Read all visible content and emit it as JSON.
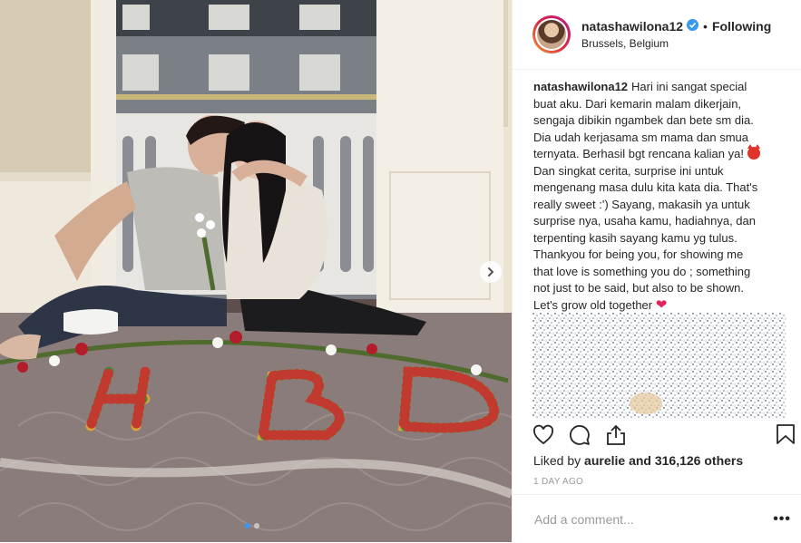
{
  "post": {
    "username": "natashawilona12",
    "follow_status": "Following",
    "separator": "•",
    "location": "Brussels, Belgium",
    "caption_lines": [
      "Hari ini sangat special",
      "buat aku. Dari kemarin malam dikerjain,",
      "sengaja dibikin ngambek dan bete sm dia.",
      "Dia udah kerjasama sm mama dan smua",
      "ternyata. Berhasil bgt rencana kalian ya!",
      "Dan singkat cerita, surprise ini untuk",
      "mengenang masa dulu kita kata dia. That's",
      "really sweet :') Sayang, makasih ya untuk",
      "surprise nya, usaha kamu, hadiahnya, dan",
      "terpenting kasih sayang kamu yg tulus.",
      "Thankyou for being you, for showing me",
      "that love is something you do ; something",
      "not just to be said, but also to be shown.",
      "Let's grow old together"
    ],
    "likes_prefix": "Liked by",
    "liked_by_user": "aurelie",
    "likes_suffix": "and 316,126 others",
    "time": "1 DAY AGO",
    "comment_placeholder": "Add a comment...",
    "more_label": "•••"
  },
  "photo": {
    "letters": "HBD",
    "carousel_pages": 2,
    "active_page": 1
  },
  "icons": [
    "verified-badge-icon",
    "heart-icon",
    "comment-icon",
    "share-icon",
    "bookmark-icon",
    "chevron-right-icon",
    "devil-emoji-icon",
    "red-heart-emoji-icon"
  ],
  "colors": {
    "verified": "#3897f0",
    "text": "#262626",
    "muted": "#999999",
    "divider": "#efefef",
    "emoji_red": "#e0342a",
    "heart": "#e0245e"
  }
}
